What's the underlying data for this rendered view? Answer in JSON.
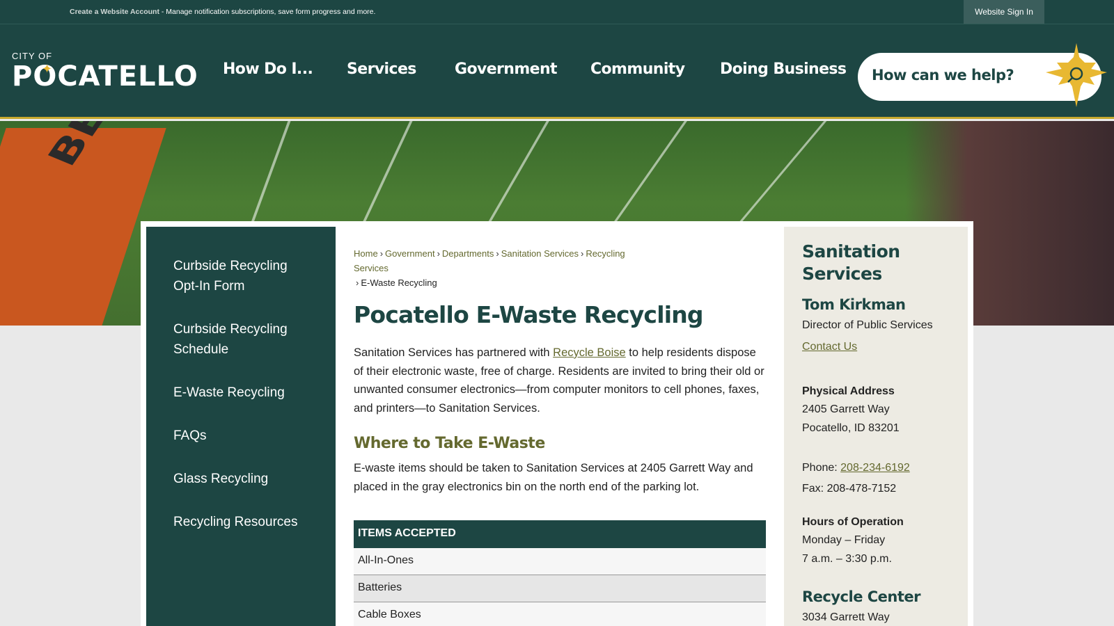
{
  "topbar": {
    "create_account": "Create a Website Account",
    "message": " - Manage notification subscriptions, save form progress and more.",
    "sign_in": "Website Sign In"
  },
  "header": {
    "logo_city": "CITY OF",
    "logo_name": "POCATELLO",
    "nav": [
      "How Do I...",
      "Services",
      "Government",
      "Community",
      "Doing Business"
    ],
    "search_placeholder": "How can we help?"
  },
  "hero": {
    "endzone_text": "BENGALS"
  },
  "sidebar": {
    "items": [
      "Curbside Recycling Opt-In Form",
      "Curbside Recycling Schedule",
      "E-Waste Recycling",
      "FAQs",
      "Glass Recycling",
      "Recycling Resources"
    ]
  },
  "breadcrumb": {
    "items": [
      "Home",
      "Government",
      "Departments",
      "Sanitation Services",
      "Recycling Services"
    ],
    "current": "E-Waste Recycling"
  },
  "content": {
    "title": "Pocatello E-Waste Recycling",
    "intro_before": "Sanitation Services has partnered with ",
    "intro_link": "Recycle Boise",
    "intro_after": " to help residents dispose of their electronic waste, free of charge. Residents are invited to bring their old or unwanted consumer electronics—from computer monitors to cell phones, faxes, and printers—to Sanitation Services.",
    "where_heading": "Where to Take E-Waste",
    "where_text": "E-waste items should be taken to Sanitation Services at 2405 Garrett Way and placed in the gray electronics bin on the north end of the parking lot.",
    "table_header": "ITEMS ACCEPTED",
    "table_rows": [
      "All-In-Ones",
      "Batteries",
      "Cable Boxes"
    ]
  },
  "contact": {
    "title": "Sanitation Services",
    "person": "Tom Kirkman",
    "role": "Director of Public Services",
    "contact_link": "Contact Us",
    "address_label": "Physical Address",
    "address_line1": "2405 Garrett Way",
    "address_line2": "Pocatello, ID 83201",
    "phone_label": "Phone: ",
    "phone": "208-234-6192",
    "fax": "Fax: 208-478-7152",
    "hours_label": "Hours of Operation",
    "hours_days": "Monday – Friday",
    "hours_time": "7 a.m. – 3:30 p.m.",
    "recycle_heading": "Recycle Center",
    "recycle_address": "3034 Garrett Way"
  },
  "colors": {
    "primary": "#1d4643",
    "accent": "#64692f",
    "gold": "#e8b832"
  }
}
